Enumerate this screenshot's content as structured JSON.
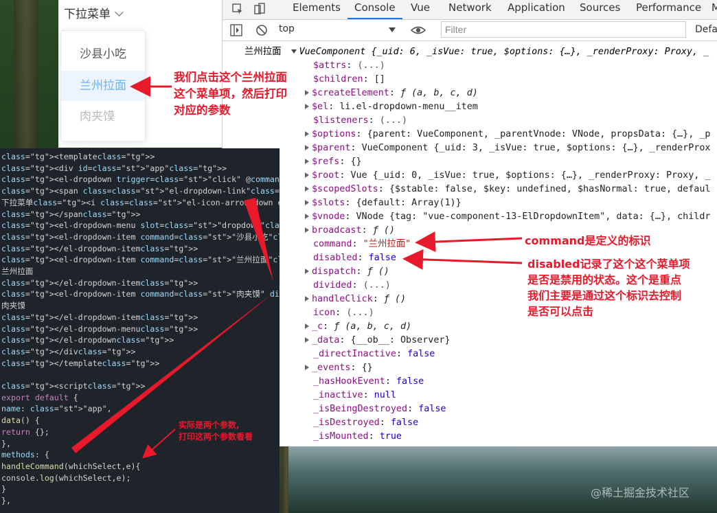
{
  "dropdown_demo": {
    "trigger_label": "下拉菜单",
    "items": [
      {
        "label": "沙县小吃",
        "state": "normal"
      },
      {
        "label": "兰州拉面",
        "state": "active"
      },
      {
        "label": "肉夹馍",
        "state": "disabled"
      }
    ]
  },
  "devtools": {
    "tabs": [
      "Elements",
      "Console",
      "Vue",
      "Network",
      "Application",
      "Sources",
      "Performance",
      "M"
    ],
    "active_tab": "Console",
    "context": "top",
    "filter_placeholder": "Filter",
    "levels_label": "Defau"
  },
  "console": {
    "log_prefix": "兰州拉面",
    "header": "VueComponent {_uid: 6, _isVue: true, $options: {…}, _renderProxy: Proxy, _",
    "props": [
      {
        "k": "$attrs",
        "v": "(...)",
        "exp": false
      },
      {
        "k": "$children",
        "v": "[]",
        "exp": false
      },
      {
        "k": "$createElement",
        "v": "ƒ (a, b, c, d)",
        "exp": true
      },
      {
        "k": "$el",
        "v": "li.el-dropdown-menu__item",
        "exp": true
      },
      {
        "k": "$listeners",
        "v": "(...)",
        "exp": false
      },
      {
        "k": "$options",
        "v": "{parent: VueComponent, _parentVnode: VNode, propsData: {…}, _p",
        "exp": true
      },
      {
        "k": "$parent",
        "v": "VueComponent {_uid: 3, _isVue: true, $options: {…}, _renderProx",
        "exp": true
      },
      {
        "k": "$refs",
        "v": "{}",
        "exp": true
      },
      {
        "k": "$root",
        "v": "Vue {_uid: 0, _isVue: true, $options: {…}, _renderProxy: Proxy, _",
        "exp": true
      },
      {
        "k": "$scopedSlots",
        "v": "{$stable: false, $key: undefined, $hasNormal: true, defaul",
        "exp": true
      },
      {
        "k": "$slots",
        "v": "{default: Array(1)}",
        "exp": true
      },
      {
        "k": "$vnode",
        "v": "VNode {tag: \"vue-component-13-ElDropdownItem\", data: {…}, childr",
        "exp": true
      },
      {
        "k": "broadcast",
        "v": "ƒ ()",
        "exp": true
      },
      {
        "k": "command",
        "v": "\"兰州拉面\"",
        "exp": false
      },
      {
        "k": "disabled",
        "v": "false",
        "exp": false
      },
      {
        "k": "dispatch",
        "v": "ƒ ()",
        "exp": true
      },
      {
        "k": "divided",
        "v": "(...)",
        "exp": false
      },
      {
        "k": "handleClick",
        "v": "ƒ ()",
        "exp": true
      },
      {
        "k": "icon",
        "v": "(...)",
        "exp": false
      },
      {
        "k": "_c",
        "v": "ƒ (a, b, c, d)",
        "exp": true
      },
      {
        "k": "_data",
        "v": "{__ob__: Observer}",
        "exp": true
      },
      {
        "k": "_directInactive",
        "v": "false",
        "exp": false
      },
      {
        "k": "_events",
        "v": "{}",
        "exp": true
      },
      {
        "k": "_hasHookEvent",
        "v": "false",
        "exp": false
      },
      {
        "k": "_inactive",
        "v": "null",
        "exp": false
      },
      {
        "k": "_isBeingDestroyed",
        "v": "false",
        "exp": false
      },
      {
        "k": "_isDestroyed",
        "v": "false",
        "exp": false
      },
      {
        "k": "_isMounted",
        "v": "true",
        "exp": false
      }
    ]
  },
  "editor": {
    "lines": [
      "<template>",
      "  <div id=\"app\">",
      "    <el-dropdown trigger=\"click\" @command=\"handleCommand\">",
      "      <span class=\"el-dropdown-link\">",
      "        下拉菜单<i class=\"el-icon-arrow-down el-icon--right\"></i>",
      "      </span>",
      "      <el-dropdown-menu slot=\"dropdown\">",
      "        <el-dropdown-item command=\"沙县小吃\">···",
      "        </el-dropdown-item>",
      "        <el-dropdown-item command=\"兰州拉面\">",
      "          兰州拉面",
      "        </el-dropdown-item>",
      "        <el-dropdown-item command=\"肉夹馍\" disabled>",
      "          肉夹馍",
      "        </el-dropdown-item>",
      "      </el-dropdown-menu>",
      "    </el-dropdown>",
      "  </div>",
      "</template>",
      "",
      "<script>",
      "export default {",
      "  name: \"app\",",
      "  data() {",
      "    return {};",
      "  },",
      "  methods: {",
      "    handleCommand(whichSelect,e){",
      "      console.log(whichSelect,e);",
      "    }",
      "  },"
    ]
  },
  "annotations": {
    "click_note": [
      "我们点击这个兰州拉面",
      "这个菜单项，然后打印",
      "对应的参数"
    ],
    "command_note": "command是定义的标识",
    "disabled_note": [
      "disabled记录了这个这个菜单项",
      "是否是禁用的状态。这个是重点",
      "我们主要是通过这个标识去控制",
      "是否可以点击"
    ],
    "params_note": [
      "实际是两个参数,",
      "打印这两个参数看看"
    ]
  },
  "watermark": "@稀土掘金技术社区",
  "colors": {
    "annotation": "#e8192a",
    "active_item_bg": "#ecf5ff",
    "active_item_text": "#66b1ff",
    "devtools_accent": "#1a73e8"
  }
}
